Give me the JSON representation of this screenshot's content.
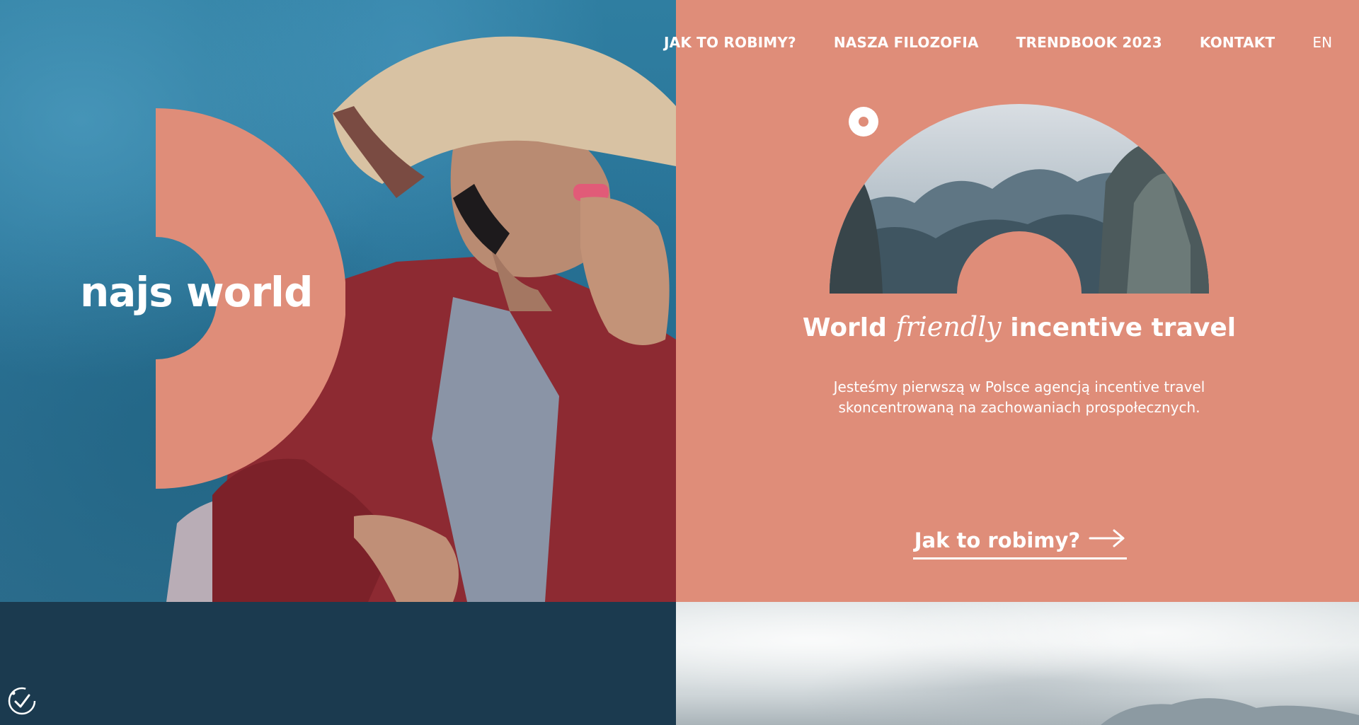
{
  "brand": {
    "logo_text": "najs world"
  },
  "nav": {
    "items": [
      {
        "label": "JAK TO ROBIMY?"
      },
      {
        "label": "NASZA FILOZOFIA"
      },
      {
        "label": "TRENDBOOK 2023"
      },
      {
        "label": "KONTAKT"
      }
    ],
    "lang": "EN"
  },
  "hero": {
    "headline_part1": "World ",
    "headline_emphasis": "friendly",
    "headline_part2": " incentive travel",
    "lead": "Jesteśmy pierwszą w Polsce agencją incentive travel skoncentrowaną na zachowaniach prospołecznych.",
    "cta_label": "Jak to robimy?"
  },
  "colors": {
    "coral": "#df8d79",
    "navy": "#1b3a4f",
    "blue": "#2c789b"
  },
  "icons": {
    "cta": "arrow-right-icon",
    "accessibility": "accessibility-check-icon"
  }
}
